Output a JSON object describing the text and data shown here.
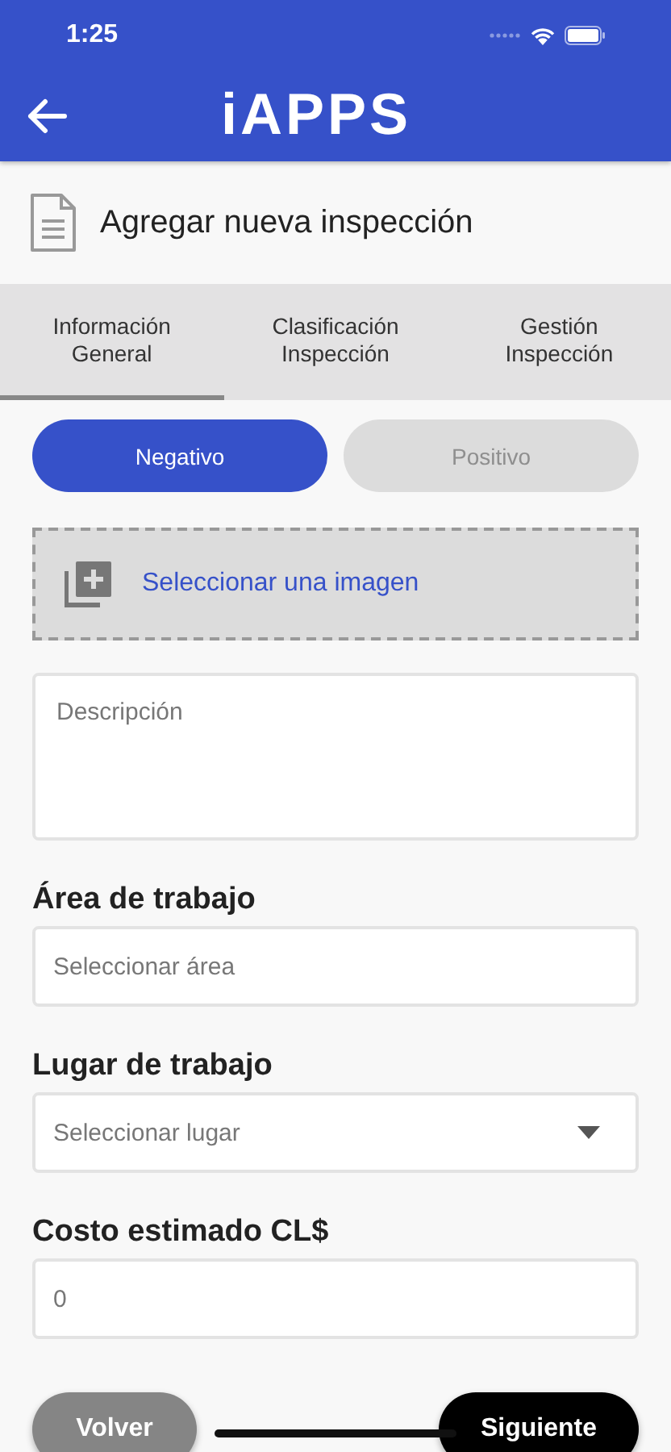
{
  "status_bar": {
    "time": "1:25"
  },
  "header": {
    "logo": "iAPPS"
  },
  "page_title": "Agregar nueva inspección",
  "tabs": [
    {
      "label": "Información General",
      "selected": true
    },
    {
      "label": "Clasificación Inspección",
      "selected": false
    },
    {
      "label": "Gestión Inspección",
      "selected": false
    }
  ],
  "result_toggle": [
    {
      "label": "Negativo",
      "selected": true
    },
    {
      "label": "Positivo",
      "selected": false
    }
  ],
  "image_picker": {
    "label": "Seleccionar una imagen"
  },
  "description": {
    "placeholder": "Descripción"
  },
  "fields": [
    {
      "label": "Área de trabajo",
      "kind": "text",
      "placeholder": "Seleccionar área"
    },
    {
      "label": "Lugar de trabajo",
      "kind": "dropdown",
      "placeholder": "Seleccionar lugar"
    },
    {
      "label": "Costo estimado CL$",
      "kind": "text",
      "placeholder": "0"
    }
  ],
  "buttons": [
    {
      "label": "Volver",
      "kind": "secondary"
    },
    {
      "label": "Siguiente",
      "kind": "primary"
    }
  ]
}
